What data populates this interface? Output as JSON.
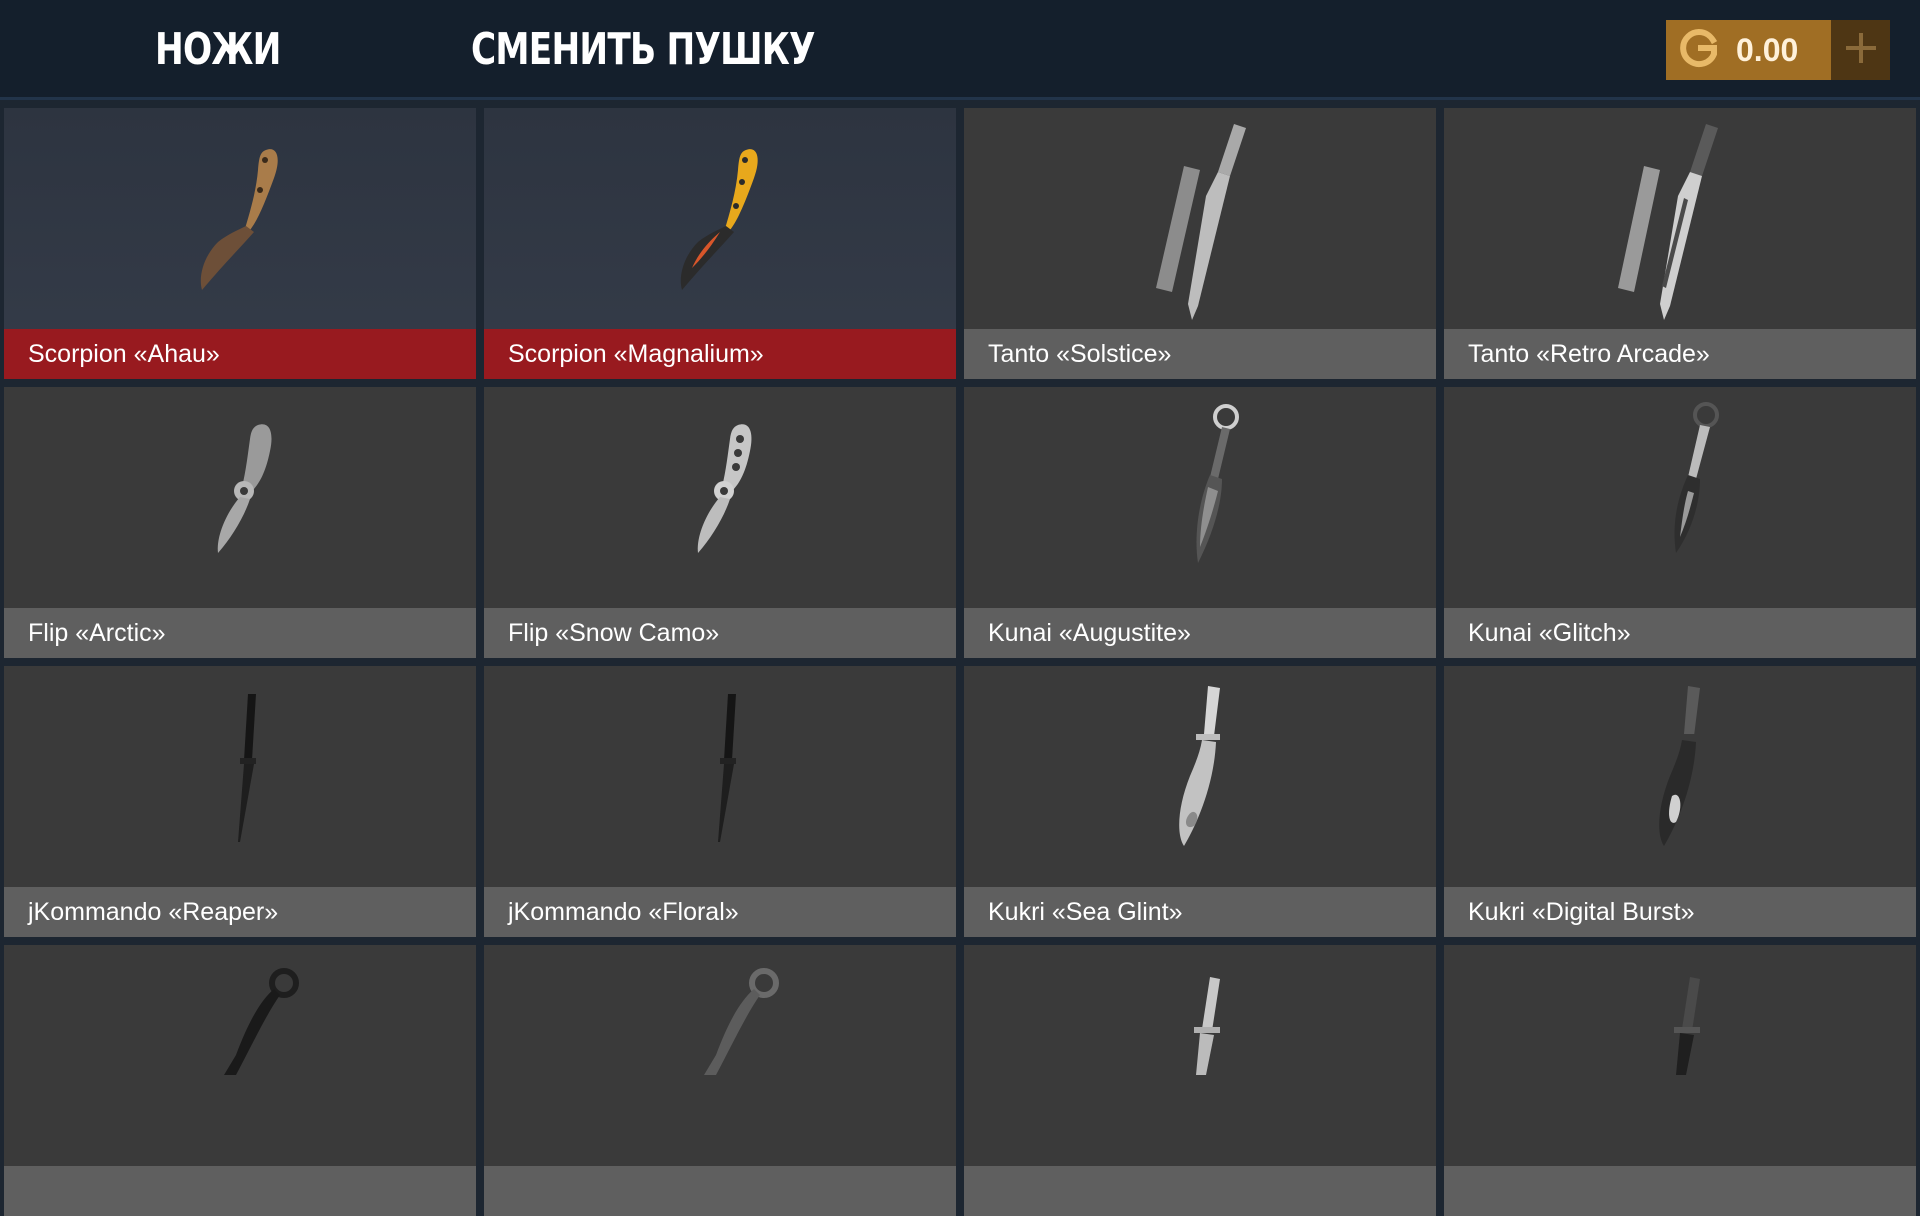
{
  "header": {
    "tab_knives": "НОЖИ",
    "tab_change_gun": "СМЕНИТЬ ПУШКУ",
    "balance": "0.00",
    "currency_icon": "g-coin-icon",
    "add_icon": "plus-icon"
  },
  "colors": {
    "header_bg": "#141f2c",
    "selected_label": "#981a1f",
    "label_bg": "#5f5f5f",
    "card_bg": "#3a3a3a",
    "gold": "#a06e24"
  },
  "items": [
    {
      "label": "Scorpion «Ahau»",
      "selected": true,
      "icon": "scorpion-knife-icon"
    },
    {
      "label": "Scorpion «Magnalium»",
      "selected": true,
      "icon": "scorpion-knife-icon"
    },
    {
      "label": "Tanto «Solstice»",
      "selected": false,
      "icon": "tanto-knife-icon"
    },
    {
      "label": "Tanto «Retro Arcade»",
      "selected": false,
      "icon": "tanto-knife-icon"
    },
    {
      "label": "Flip «Arctic»",
      "selected": false,
      "icon": "flip-knife-icon"
    },
    {
      "label": "Flip «Snow Camo»",
      "selected": false,
      "icon": "flip-knife-icon"
    },
    {
      "label": "Kunai «Augustite»",
      "selected": false,
      "icon": "kunai-knife-icon"
    },
    {
      "label": "Kunai «Glitch»",
      "selected": false,
      "icon": "kunai-knife-icon"
    },
    {
      "label": "jKommando «Reaper»",
      "selected": false,
      "icon": "jkommando-knife-icon"
    },
    {
      "label": "jKommando «Floral»",
      "selected": false,
      "icon": "jkommando-knife-icon"
    },
    {
      "label": "Kukri «Sea Glint»",
      "selected": false,
      "icon": "kukri-knife-icon"
    },
    {
      "label": "Kukri «Digital Burst»",
      "selected": false,
      "icon": "kukri-knife-icon"
    },
    {
      "label": "",
      "selected": false,
      "icon": "karambit-knife-icon"
    },
    {
      "label": "",
      "selected": false,
      "icon": "karambit-knife-icon"
    },
    {
      "label": "",
      "selected": false,
      "icon": "dagger-knife-icon"
    },
    {
      "label": "",
      "selected": false,
      "icon": "dagger-knife-icon"
    }
  ]
}
